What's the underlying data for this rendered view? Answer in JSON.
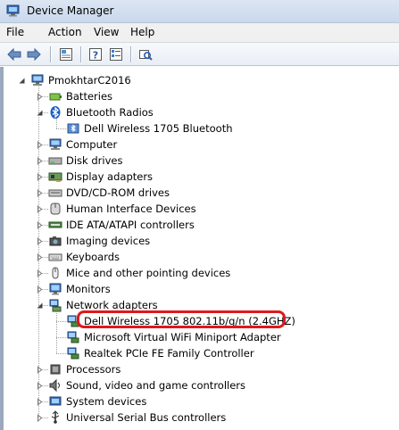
{
  "window": {
    "title": "Device Manager",
    "app_icon": "device-manager-icon"
  },
  "menu": [
    "File",
    "Action",
    "View",
    "Help"
  ],
  "toolbar": {
    "buttons": [
      "back-arrow-icon",
      "forward-arrow-icon",
      "properties-icon",
      "help-icon",
      "device-list-icon",
      "scan-hardware-icon"
    ]
  },
  "tree": {
    "root": {
      "label": "PmokhtarC2016",
      "icon": "computer-icon",
      "expanded": true
    },
    "categories": [
      {
        "label": "Batteries",
        "icon": "battery-icon",
        "expanded": false
      },
      {
        "label": "Bluetooth Radios",
        "icon": "bluetooth-icon",
        "expanded": true,
        "children": [
          {
            "label": "Dell Wireless 1705 Bluetooth",
            "icon": "bluetooth-device-icon"
          }
        ]
      },
      {
        "label": "Computer",
        "icon": "computer-icon",
        "expanded": false
      },
      {
        "label": "Disk drives",
        "icon": "disk-drive-icon",
        "expanded": false
      },
      {
        "label": "Display adapters",
        "icon": "display-adapter-icon",
        "expanded": false
      },
      {
        "label": "DVD/CD-ROM drives",
        "icon": "dvd-drive-icon",
        "expanded": false
      },
      {
        "label": "Human Interface Devices",
        "icon": "hid-icon",
        "expanded": false
      },
      {
        "label": "IDE ATA/ATAPI controllers",
        "icon": "ide-controller-icon",
        "expanded": false
      },
      {
        "label": "Imaging devices",
        "icon": "camera-icon",
        "expanded": false
      },
      {
        "label": "Keyboards",
        "icon": "keyboard-icon",
        "expanded": false
      },
      {
        "label": "Mice and other pointing devices",
        "icon": "mouse-icon",
        "expanded": false
      },
      {
        "label": "Monitors",
        "icon": "monitor-icon",
        "expanded": false
      },
      {
        "label": "Network adapters",
        "icon": "network-adapter-icon",
        "expanded": true,
        "children": [
          {
            "label": "Dell Wireless 1705 802.11b/g/n (2.4GHZ)",
            "icon": "network-card-icon",
            "highlighted": true
          },
          {
            "label": "Microsoft Virtual WiFi Miniport Adapter",
            "icon": "network-card-icon"
          },
          {
            "label": "Realtek PCIe FE Family Controller",
            "icon": "network-card-icon"
          }
        ]
      },
      {
        "label": "Processors",
        "icon": "processor-icon",
        "expanded": false
      },
      {
        "label": "Sound, video and game controllers",
        "icon": "sound-icon",
        "expanded": false
      },
      {
        "label": "System devices",
        "icon": "system-device-icon",
        "expanded": false
      },
      {
        "label": "Universal Serial Bus controllers",
        "icon": "usb-icon",
        "expanded": false
      }
    ]
  },
  "colors": {
    "highlight_outline": "#e0181c",
    "titlebar": "#c9d8ec",
    "menubar": "#f0f0f0"
  }
}
